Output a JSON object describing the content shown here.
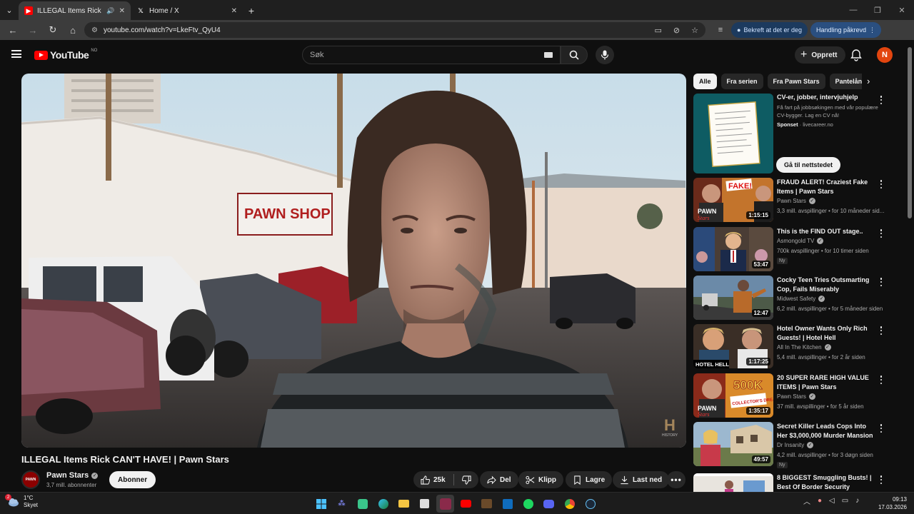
{
  "browser": {
    "tabs": [
      {
        "title": "ILLEGAL Items Rick CAN'T H",
        "icon": "youtube-icon",
        "active": true
      },
      {
        "title": "Home / X",
        "icon": "x-icon",
        "active": false
      }
    ],
    "url": "youtube.com/watch?v=LkeFtv_QyU4",
    "verify_pill": "Bekreft at det er deg",
    "action_pill": "Handling påkrevd"
  },
  "youtube": {
    "logo_text": "YouTube",
    "country_code": "NO",
    "search_placeholder": "Søk",
    "create_label": "Opprett",
    "avatar_letter": "N"
  },
  "video": {
    "title": "ILLEGAL Items Rick CAN'T HAVE! | Pawn Stars",
    "channel": "Pawn Stars",
    "subscribers": "3,7 mill. abonnenter",
    "subscribe_label": "Abonner",
    "likes": "25k",
    "share_label": "Del",
    "clip_label": "Klipp",
    "save_label": "Lagre",
    "download_label": "Last ned",
    "scene_sign": "PAWN SHOP",
    "watermark": "HISTORY"
  },
  "chips": [
    "Alle",
    "Fra serien",
    "Fra Pawn Stars",
    "Pantelåne"
  ],
  "ad": {
    "title": "CV-er, jobber, intervjuhjelp",
    "description": "Få fart på jobbsøkingen med vår populære CV-bygger. Lag en CV nå!",
    "sponsored": "Sponset",
    "domain": "livecareer.no",
    "cta": "Gå til nettstedet"
  },
  "recommendations": [
    {
      "title": "FRAUD ALERT! Craziest Fake Items | Pawn Stars",
      "channel": "Pawn Stars",
      "verified": true,
      "meta": "3,3 mill. avspillinger • for 10 måneder sid...",
      "duration": "1:15:15",
      "new": false
    },
    {
      "title": "This is the FIND OUT stage..",
      "channel": "Asmongold TV",
      "verified": true,
      "meta": "700k avspillinger • for 10 timer siden",
      "duration": "53:47",
      "new": true,
      "new_label": "Ny"
    },
    {
      "title": "Cocky Teen Tries Outsmarting Cop, Fails Miserably",
      "channel": "Midwest Safety",
      "verified": true,
      "meta": "6,2 mill. avspillinger • for 5 måneder siden",
      "duration": "12:47",
      "new": false
    },
    {
      "title": "Hotel Owner Wants Only Rich Guests! | Hotel Hell",
      "channel": "All In The Kitchen",
      "verified": true,
      "meta": "5,4 mill. avspillinger • for 2 år siden",
      "duration": "1:17:25",
      "new": false
    },
    {
      "title": "20 SUPER RARE HIGH VALUE ITEMS | Pawn Stars",
      "channel": "Pawn Stars",
      "verified": true,
      "meta": "37 mill. avspillinger • for 5 år siden",
      "duration": "1:35:17",
      "new": false
    },
    {
      "title": "Secret Killer Leads Cops Into Her $3,000,000 Murder Mansion",
      "channel": "Dr Insanity",
      "verified": true,
      "meta": "4,2 mill. avspillinger • for 3 døgn siden",
      "duration": "49:57",
      "new": true,
      "new_label": "Ny"
    },
    {
      "title": "8 BIGGEST Smuggling Busts! | Best Of Border Security",
      "channel": "",
      "verified": false,
      "meta": "",
      "duration": "",
      "new": false
    }
  ],
  "thumb_text": {
    "fake": "FAKE!",
    "pawn": "PAWN",
    "stars": "Stars",
    "hotel": "HOTEL HELL",
    "value": "500K",
    "collectors": "COLLECTOR'S DREAM"
  },
  "taskbar": {
    "temperature": "1°C",
    "weather": "Skyet",
    "weather_badge": "2",
    "time": "09:13",
    "date": "17.03.2026"
  },
  "colors": {
    "accent_red": "#ff0000",
    "avatar": "#e2450f",
    "background": "#0f0f0f"
  }
}
